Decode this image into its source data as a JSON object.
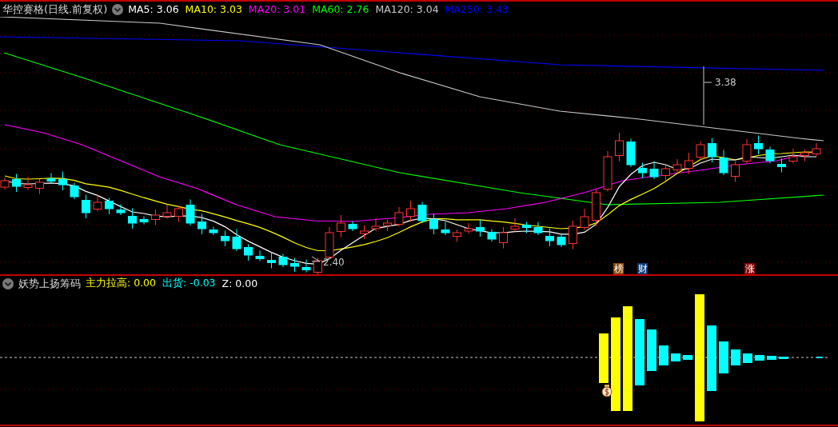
{
  "main_chart": {
    "title": "华控赛格(日线.前复权)",
    "indicators": [
      {
        "label": "MA5: 3.06",
        "color": "#ffffff"
      },
      {
        "label": "MA10: 3.03",
        "color": "#ffff00"
      },
      {
        "label": "MA20: 3.01",
        "color": "#ff00ff"
      },
      {
        "label": "MA60: 2.76",
        "color": "#00ff00"
      },
      {
        "label": "MA120: 3.04",
        "color": "#c8c8c8"
      },
      {
        "label": "MA250: 3.43",
        "color": "#0000ff"
      }
    ],
    "high_marker": "3.38",
    "low_marker": "2.40",
    "event_tags": [
      {
        "label": "榜",
        "color": "#8b4a0a"
      },
      {
        "label": "财",
        "color": "#0a3a78"
      },
      {
        "label": "涨",
        "color": "#8b0000"
      }
    ]
  },
  "sub_chart": {
    "title": "妖势上扬筹码",
    "indicators": [
      {
        "label": "主力拉高: 0.00",
        "color": "#ffff00"
      },
      {
        "label": "出货: -0.03",
        "color": "#00ffff"
      },
      {
        "label": "Z: 0.00",
        "color": "#ffffff"
      }
    ]
  }
}
